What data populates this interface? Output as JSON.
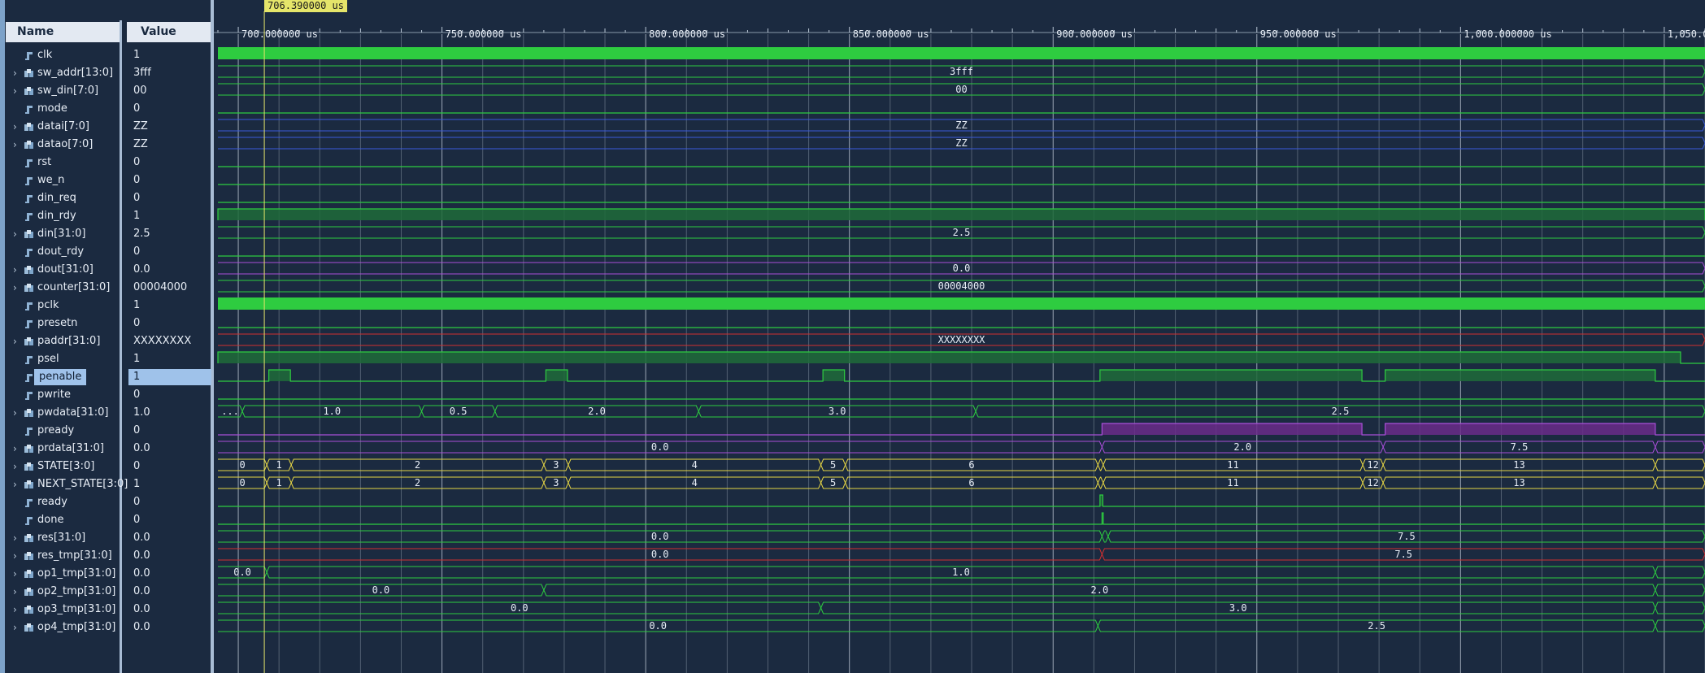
{
  "header": {
    "name_col": "Name",
    "value_col": "Value"
  },
  "cursor": {
    "time_text": "706.390000 us",
    "time_us": 706.39
  },
  "timeline": {
    "start_us": 695.0,
    "end_us": 1060.0,
    "major_ticks": [
      {
        "t": 700,
        "label": "700.000000 us"
      },
      {
        "t": 750,
        "label": "750.000000 us"
      },
      {
        "t": 800,
        "label": "800.000000 us"
      },
      {
        "t": 850,
        "label": "850.000000 us"
      },
      {
        "t": 900,
        "label": "900.000000 us"
      },
      {
        "t": 950,
        "label": "950.000000 us"
      },
      {
        "t": 1000,
        "label": "1,000.000000 us"
      },
      {
        "t": 1050,
        "label": "1,050.0"
      }
    ]
  },
  "signals": [
    {
      "name": "clk",
      "value": "1",
      "kind": "bit",
      "expandable": false,
      "wave": {
        "type": "clock"
      }
    },
    {
      "name": "sw_addr[13:0]",
      "value": "3fff",
      "kind": "bus",
      "expandable": true,
      "wave": {
        "type": "bus",
        "color": "#2ecc40",
        "segments": [
          {
            "from": 695,
            "to": 1060,
            "text": "3fff"
          }
        ]
      }
    },
    {
      "name": "sw_din[7:0]",
      "value": "00",
      "kind": "bus",
      "expandable": true,
      "wave": {
        "type": "bus",
        "color": "#2ecc40",
        "segments": [
          {
            "from": 695,
            "to": 1060,
            "text": "00"
          }
        ]
      }
    },
    {
      "name": "mode",
      "value": "0",
      "kind": "bit",
      "expandable": false,
      "wave": {
        "type": "bit",
        "highs": []
      }
    },
    {
      "name": "datai[7:0]",
      "value": "ZZ",
      "kind": "bus",
      "expandable": true,
      "wave": {
        "type": "bus",
        "color": "#3b5bdb",
        "segments": [
          {
            "from": 695,
            "to": 1060,
            "text": "ZZ"
          }
        ]
      }
    },
    {
      "name": "datao[7:0]",
      "value": "ZZ",
      "kind": "bus",
      "expandable": true,
      "wave": {
        "type": "bus",
        "color": "#3b5bdb",
        "segments": [
          {
            "from": 695,
            "to": 1060,
            "text": "ZZ"
          }
        ]
      }
    },
    {
      "name": "rst",
      "value": "0",
      "kind": "bit",
      "expandable": false,
      "wave": {
        "type": "bit",
        "highs": []
      }
    },
    {
      "name": "we_n",
      "value": "0",
      "kind": "bit",
      "expandable": false,
      "wave": {
        "type": "bit",
        "highs": []
      }
    },
    {
      "name": "din_req",
      "value": "0",
      "kind": "bit",
      "expandable": false,
      "wave": {
        "type": "bit",
        "highs": []
      }
    },
    {
      "name": "din_rdy",
      "value": "1",
      "kind": "bit",
      "expandable": false,
      "wave": {
        "type": "bit",
        "highs": [
          [
            695,
            1060
          ]
        ]
      }
    },
    {
      "name": "din[31:0]",
      "value": "2.5",
      "kind": "bus",
      "expandable": true,
      "wave": {
        "type": "bus",
        "color": "#2ecc40",
        "segments": [
          {
            "from": 695,
            "to": 1060,
            "text": "2.5"
          }
        ]
      }
    },
    {
      "name": "dout_rdy",
      "value": "0",
      "kind": "bit",
      "expandable": false,
      "wave": {
        "type": "bit",
        "highs": []
      }
    },
    {
      "name": "dout[31:0]",
      "value": "0.0",
      "kind": "bus",
      "expandable": true,
      "wave": {
        "type": "bus",
        "color": "#a84fd8",
        "segments": [
          {
            "from": 695,
            "to": 1060,
            "text": "0.0"
          }
        ]
      }
    },
    {
      "name": "counter[31:0]",
      "value": "00004000",
      "kind": "bus",
      "expandable": true,
      "wave": {
        "type": "bus",
        "color": "#2ecc40",
        "segments": [
          {
            "from": 695,
            "to": 1060,
            "text": "00004000"
          }
        ]
      }
    },
    {
      "name": "pclk",
      "value": "1",
      "kind": "bit",
      "expandable": false,
      "wave": {
        "type": "clock"
      }
    },
    {
      "name": "presetn",
      "value": "0",
      "kind": "bit",
      "expandable": false,
      "wave": {
        "type": "bit",
        "highs": []
      }
    },
    {
      "name": "paddr[31:0]",
      "value": "XXXXXXXX",
      "kind": "bus",
      "expandable": true,
      "wave": {
        "type": "xbus",
        "color": "#d03030",
        "segments": [
          {
            "from": 695,
            "to": 1060,
            "text": "XXXXXXXX"
          }
        ]
      }
    },
    {
      "name": "psel",
      "value": "1",
      "kind": "bit",
      "expandable": false,
      "wave": {
        "type": "bit",
        "highs": [
          [
            695,
            1054
          ]
        ]
      }
    },
    {
      "name": "penable",
      "value": "1",
      "kind": "bit",
      "expandable": false,
      "selected": true,
      "wave": {
        "type": "bit",
        "highs": [
          [
            707.5,
            712.8
          ],
          [
            775.5,
            780.8
          ],
          [
            843.5,
            848.8
          ],
          [
            911.5,
            975.8
          ],
          [
            981.5,
            1047.8
          ]
        ]
      }
    },
    {
      "name": "pwrite",
      "value": "0",
      "kind": "bit",
      "expandable": false,
      "wave": {
        "type": "bit",
        "highs": []
      }
    },
    {
      "name": "pwdata[31:0]",
      "value": "1.0",
      "kind": "bus",
      "expandable": true,
      "wave": {
        "type": "bus",
        "color": "#2ecc40",
        "segments": [
          {
            "from": 695,
            "to": 701,
            "text": "..."
          },
          {
            "from": 701,
            "to": 745,
            "text": "1.0"
          },
          {
            "from": 745,
            "to": 763,
            "text": "0.5"
          },
          {
            "from": 763,
            "to": 813,
            "text": "2.0"
          },
          {
            "from": 813,
            "to": 881,
            "text": "3.0"
          },
          {
            "from": 881,
            "to": 1060,
            "text": "2.5"
          }
        ]
      }
    },
    {
      "name": "pready",
      "value": "0",
      "kind": "bit",
      "expandable": false,
      "wave": {
        "type": "bit",
        "highs": [
          [
            912,
            975.8
          ],
          [
            981.5,
            1047.8
          ]
        ],
        "color": "#a84fd8"
      }
    },
    {
      "name": "prdata[31:0]",
      "value": "0.0",
      "kind": "bus",
      "expandable": true,
      "wave": {
        "type": "bus",
        "color": "#a84fd8",
        "segments": [
          {
            "from": 695,
            "to": 912,
            "text": "0.0"
          },
          {
            "from": 912,
            "to": 981,
            "text": "2.0"
          },
          {
            "from": 981,
            "to": 1047.8,
            "text": "7.5"
          },
          {
            "from": 1047.8,
            "to": 1060,
            "text": ""
          }
        ]
      }
    },
    {
      "name": "STATE[3:0]",
      "value": "0",
      "kind": "bus",
      "expandable": true,
      "wave": {
        "type": "bus",
        "color": "#e5d545",
        "segments": [
          {
            "from": 695,
            "to": 707,
            "text": "0"
          },
          {
            "from": 707,
            "to": 713,
            "text": "1"
          },
          {
            "from": 713,
            "to": 775,
            "text": "2"
          },
          {
            "from": 775,
            "to": 781,
            "text": "3"
          },
          {
            "from": 781,
            "to": 843,
            "text": "4"
          },
          {
            "from": 843,
            "to": 849,
            "text": "5"
          },
          {
            "from": 849,
            "to": 911,
            "text": "6"
          },
          {
            "from": 911,
            "to": 912.3,
            "text": ""
          },
          {
            "from": 912.3,
            "to": 976,
            "text": "11"
          },
          {
            "from": 976,
            "to": 981,
            "text": "12"
          },
          {
            "from": 981,
            "to": 1047.8,
            "text": "13"
          },
          {
            "from": 1047.8,
            "to": 1060,
            "text": ""
          }
        ]
      }
    },
    {
      "name": "NEXT_STATE[3:0]",
      "value": "1",
      "kind": "bus",
      "expandable": true,
      "wave": {
        "type": "bus",
        "color": "#e5d545",
        "segments": [
          {
            "from": 695,
            "to": 707,
            "text": "0"
          },
          {
            "from": 707,
            "to": 713,
            "text": "1"
          },
          {
            "from": 713,
            "to": 775,
            "text": "2"
          },
          {
            "from": 775,
            "to": 781,
            "text": "3"
          },
          {
            "from": 781,
            "to": 843,
            "text": "4"
          },
          {
            "from": 843,
            "to": 849,
            "text": "5"
          },
          {
            "from": 849,
            "to": 911,
            "text": "6"
          },
          {
            "from": 911,
            "to": 912.3,
            "text": ""
          },
          {
            "from": 912.3,
            "to": 976,
            "text": "11"
          },
          {
            "from": 976,
            "to": 981,
            "text": "12"
          },
          {
            "from": 981,
            "to": 1047.8,
            "text": "13"
          },
          {
            "from": 1047.8,
            "to": 1060,
            "text": ""
          }
        ]
      }
    },
    {
      "name": "ready",
      "value": "0",
      "kind": "bit",
      "expandable": false,
      "wave": {
        "type": "bit",
        "highs": [
          [
            911.5,
            912.2
          ]
        ]
      }
    },
    {
      "name": "done",
      "value": "0",
      "kind": "bit",
      "expandable": false,
      "wave": {
        "type": "bit",
        "highs": [
          [
            912,
            912.3
          ]
        ]
      }
    },
    {
      "name": "res[31:0]",
      "value": "0.0",
      "kind": "bus",
      "expandable": true,
      "wave": {
        "type": "bus",
        "color": "#2ecc40",
        "segments": [
          {
            "from": 695,
            "to": 912,
            "text": "0.0"
          },
          {
            "from": 912,
            "to": 913.5,
            "text": ""
          },
          {
            "from": 913.5,
            "to": 1060,
            "text": "7.5"
          }
        ]
      }
    },
    {
      "name": "res_tmp[31:0]",
      "value": "0.0",
      "kind": "bus",
      "expandable": true,
      "wave": {
        "type": "bus",
        "color": "#d03030",
        "segments": [
          {
            "from": 695,
            "to": 912,
            "text": "0.0"
          },
          {
            "from": 912,
            "to": 1060,
            "text": "7.5"
          }
        ]
      }
    },
    {
      "name": "op1_tmp[31:0]",
      "value": "0.0",
      "kind": "bus",
      "expandable": true,
      "wave": {
        "type": "bus",
        "color": "#2ecc40",
        "segments": [
          {
            "from": 695,
            "to": 707,
            "text": "0.0"
          },
          {
            "from": 707,
            "to": 1047.8,
            "text": "1.0"
          },
          {
            "from": 1047.8,
            "to": 1060,
            "text": ""
          }
        ]
      }
    },
    {
      "name": "op2_tmp[31:0]",
      "value": "0.0",
      "kind": "bus",
      "expandable": true,
      "wave": {
        "type": "bus",
        "color": "#2ecc40",
        "segments": [
          {
            "from": 695,
            "to": 775,
            "text": "0.0"
          },
          {
            "from": 775,
            "to": 1047.8,
            "text": "2.0"
          },
          {
            "from": 1047.8,
            "to": 1060,
            "text": ""
          }
        ]
      }
    },
    {
      "name": "op3_tmp[31:0]",
      "value": "0.0",
      "kind": "bus",
      "expandable": true,
      "wave": {
        "type": "bus",
        "color": "#2ecc40",
        "segments": [
          {
            "from": 695,
            "to": 843,
            "text": "0.0"
          },
          {
            "from": 843,
            "to": 1047.8,
            "text": "3.0"
          },
          {
            "from": 1047.8,
            "to": 1060,
            "text": ""
          }
        ]
      }
    },
    {
      "name": "op4_tmp[31:0]",
      "value": "0.0",
      "kind": "bus",
      "expandable": true,
      "wave": {
        "type": "bus",
        "color": "#2ecc40",
        "segments": [
          {
            "from": 695,
            "to": 911,
            "text": "0.0"
          },
          {
            "from": 911,
            "to": 1047.8,
            "text": "2.5"
          },
          {
            "from": 1047.8,
            "to": 1060,
            "text": ""
          }
        ]
      }
    }
  ],
  "colors": {
    "background": "#1b2a40",
    "grid": "#c8d2de",
    "wave_green": "#2ecc40",
    "wave_fill": "#1e6b3a",
    "cursor": "#e5e56a",
    "selection": "#9fc2ea"
  }
}
